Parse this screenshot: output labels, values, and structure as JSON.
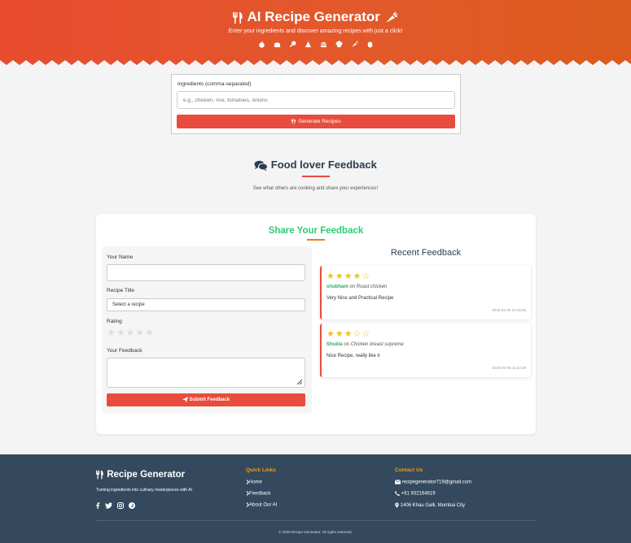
{
  "header": {
    "title": "AI Recipe Generator",
    "subtitle": "Enter your ingredients and discover amazing recipes with just a click!",
    "food_icons": [
      "apple-icon",
      "cake-icon",
      "drumstick-icon",
      "pizza-icon",
      "burger-icon",
      "chef-hat-icon",
      "carrot-icon",
      "egg-icon"
    ]
  },
  "ingredients_form": {
    "label": "Ingredients (comma-separated)",
    "placeholder": "e.g., chicken, rice, tomatoes, onions",
    "button_label": "Generate Recipes"
  },
  "feedback_section": {
    "title": "Food lover Feedback",
    "subtitle": "See what others are cooking and share your experiences!"
  },
  "feedback_form": {
    "title": "Share Your Feedback",
    "name_label": "Your Name",
    "recipe_label": "Recipe Title",
    "recipe_selected": "Select a recipe",
    "rating_label": "Rating",
    "rating_value": 0,
    "rating_max": 5,
    "feedback_label": "Your Feedback",
    "submit_label": "Submit Feedback"
  },
  "recent_feedback": {
    "title": "Recent Feedback",
    "items": [
      {
        "user": "shubham",
        "on": "on",
        "recipe": "Roast chicken",
        "rating": 4,
        "message": "Very Nice and Practical Recipe",
        "timestamp": "2025-04-06 10:15:55"
      },
      {
        "user": "Shukla",
        "on": "on",
        "recipe": "Chicken breast supreme",
        "rating": 3,
        "message": "Nice Recipe, really like it",
        "timestamp": "2025-04-06 11:33:29"
      }
    ]
  },
  "footer": {
    "brand": "Recipe Generator",
    "tagline": "Turning ingredients into culinary masterpieces with AI",
    "social": [
      "facebook-icon",
      "twitter-icon",
      "instagram-icon",
      "pinterest-icon"
    ],
    "quick_links_title": "Quick Links",
    "links": [
      "Home",
      "Feedback",
      "About Our AI"
    ],
    "contact_title": "Contact Us",
    "email": "recipegenerator719@gmail.com",
    "phone": "+91 932164619",
    "address": "1406 Khau Galli, Mumbai City",
    "copyright": "© 2025 Recipe Generator. All rights reserved."
  },
  "colors": {
    "header_start": "#e84c2f",
    "header_end": "#dc5a1d",
    "button": "#e74c3c",
    "share_title": "#2ecc71",
    "star": "#f1c40f",
    "footer_bg": "#34495e",
    "footer_heading": "#f39c12"
  }
}
